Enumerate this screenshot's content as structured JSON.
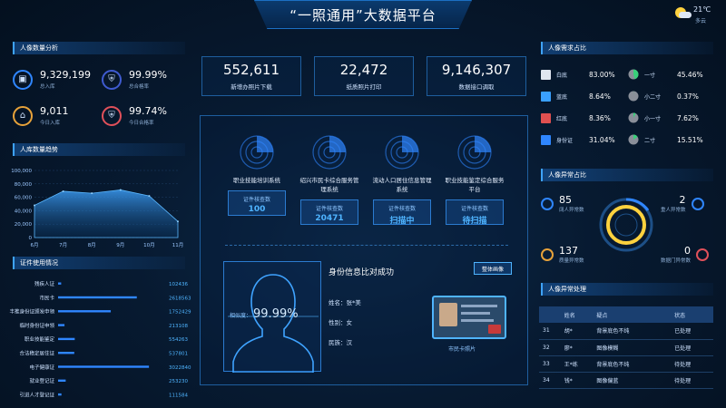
{
  "title": "“一照通用”大数据平台",
  "weather": {
    "temp": "21℃",
    "desc": "多云"
  },
  "left": {
    "stats_title": "人像数量分析",
    "stats": [
      {
        "value": "9,329,199",
        "label": "总入库",
        "color": "#2f86ff",
        "icon": "user-card-icon"
      },
      {
        "value": "99.99%",
        "label": "总合格率",
        "color": "#3f5bd0",
        "icon": "shield-icon"
      },
      {
        "value": "9,011",
        "label": "今日入库",
        "color": "#e7a23a",
        "icon": "inbox-icon"
      },
      {
        "value": "99.74%",
        "label": "今日合格率",
        "color": "#e0505a",
        "icon": "shield-check-icon"
      }
    ],
    "trend_title": "人库数量趋势",
    "usage_title": "证件使用情况"
  },
  "top_cards": [
    {
      "value": "552,611",
      "label": "新增办照片下载"
    },
    {
      "value": "22,472",
      "label": "纸质照片打印"
    },
    {
      "value": "9,146,307",
      "label": "数据接口调取"
    }
  ],
  "radars": [
    {
      "label": "职业技能培训系统",
      "card_label": "证件核查数",
      "card_value": "100"
    },
    {
      "label": "绍兴市民卡综合服务管理系统",
      "card_label": "证件核查数",
      "card_value": "20471"
    },
    {
      "label": "流动人口居住信息管理系统",
      "card_label": "证件核查数",
      "card_value": "扫描中"
    },
    {
      "label": "职业技能鉴定综合服务平台",
      "card_label": "证件核查数",
      "card_value": "待扫描"
    }
  ],
  "verify": {
    "title": "身份信息比对成功",
    "button": "整体画像",
    "similarity_label": "相似度：",
    "similarity": "99.99%",
    "name_label": "姓名：",
    "name": "张*美",
    "gender_label": "性别：",
    "gender": "女",
    "ethnic_label": "民族：",
    "ethnic": "汉",
    "card_caption": "市民卡照片"
  },
  "right": {
    "demand_title": "人像需求占比",
    "demand": [
      {
        "name": "白底",
        "value": "83.00%",
        "color": "#e0e6f0"
      },
      {
        "name": "蓝底",
        "value": "8.64%",
        "color": "#3aa0ff"
      },
      {
        "name": "红底",
        "value": "8.36%",
        "color": "#e05050"
      },
      {
        "name": "身份证",
        "value": "31.04%",
        "color": "#2f86ff"
      }
    ],
    "sizes": [
      {
        "name": "一寸",
        "value": "45.46%",
        "color": "#38d07a",
        "fraction": 0.4546
      },
      {
        "name": "小二寸",
        "value": "0.37%",
        "color": "#38d07a",
        "fraction": 0.0037
      },
      {
        "name": "小一寸",
        "value": "7.62%",
        "color": "#38d07a",
        "fraction": 0.0762
      },
      {
        "name": "二寸",
        "value": "15.51%",
        "color": "#38d07a",
        "fraction": 0.1551
      }
    ],
    "anomaly_title": "人像异常占比",
    "anomalies": [
      {
        "value": "85",
        "label": "阔人异常数",
        "color": "#2f86ff"
      },
      {
        "value": "2",
        "label": "重人异常数",
        "color": "#2f86ff"
      },
      {
        "value": "137",
        "label": "质量异常数",
        "color": "#e7a23a"
      },
      {
        "value": "0",
        "label": "数据门异常数",
        "color": "#e0505a"
      }
    ],
    "process_title": "人像异常处理",
    "process_headers": [
      "",
      "姓名",
      "疑点",
      "状态"
    ],
    "process_rows": [
      [
        "31",
        "胡*",
        "背景底色不纯",
        "已处理"
      ],
      [
        "32",
        "廖*",
        "图像模糊",
        "已处理"
      ],
      [
        "33",
        "王*练",
        "背景底色不纯",
        "待处理"
      ],
      [
        "34",
        "钱*",
        "图像偏蓝",
        "待处理"
      ]
    ]
  },
  "chart_data": {
    "type": "area",
    "title": "人库数量趋势",
    "categories": [
      "6月",
      "7月",
      "8月",
      "9月",
      "10月",
      "11月"
    ],
    "series": [
      {
        "values": [
          48000,
          69000,
          66000,
          71000,
          62000,
          24000
        ]
      }
    ],
    "ylim": [
      0,
      100000
    ],
    "yticks": [
      "0",
      "20,000",
      "40,000",
      "60,000",
      "80,000",
      "100,000"
    ],
    "grid": true
  },
  "usage_chart": {
    "type": "bar",
    "categories": [
      "残疾人证",
      "市民卡",
      "丰推身份证颁发申领",
      "临时身份证申领",
      "职业技能鉴定",
      "合法稳定居住证",
      "电子健康证",
      "就业登记证",
      "引进人才登记证"
    ],
    "values": [
      102436,
      2618563,
      1752429,
      213108,
      554263,
      537801,
      3022840,
      253230,
      111584
    ],
    "value_labels": [
      "102436",
      "2618563",
      "1752429",
      "213108",
      "554263",
      "537801",
      "3022840",
      "253230",
      "111584"
    ],
    "xlim": [
      0,
      3200000
    ]
  }
}
